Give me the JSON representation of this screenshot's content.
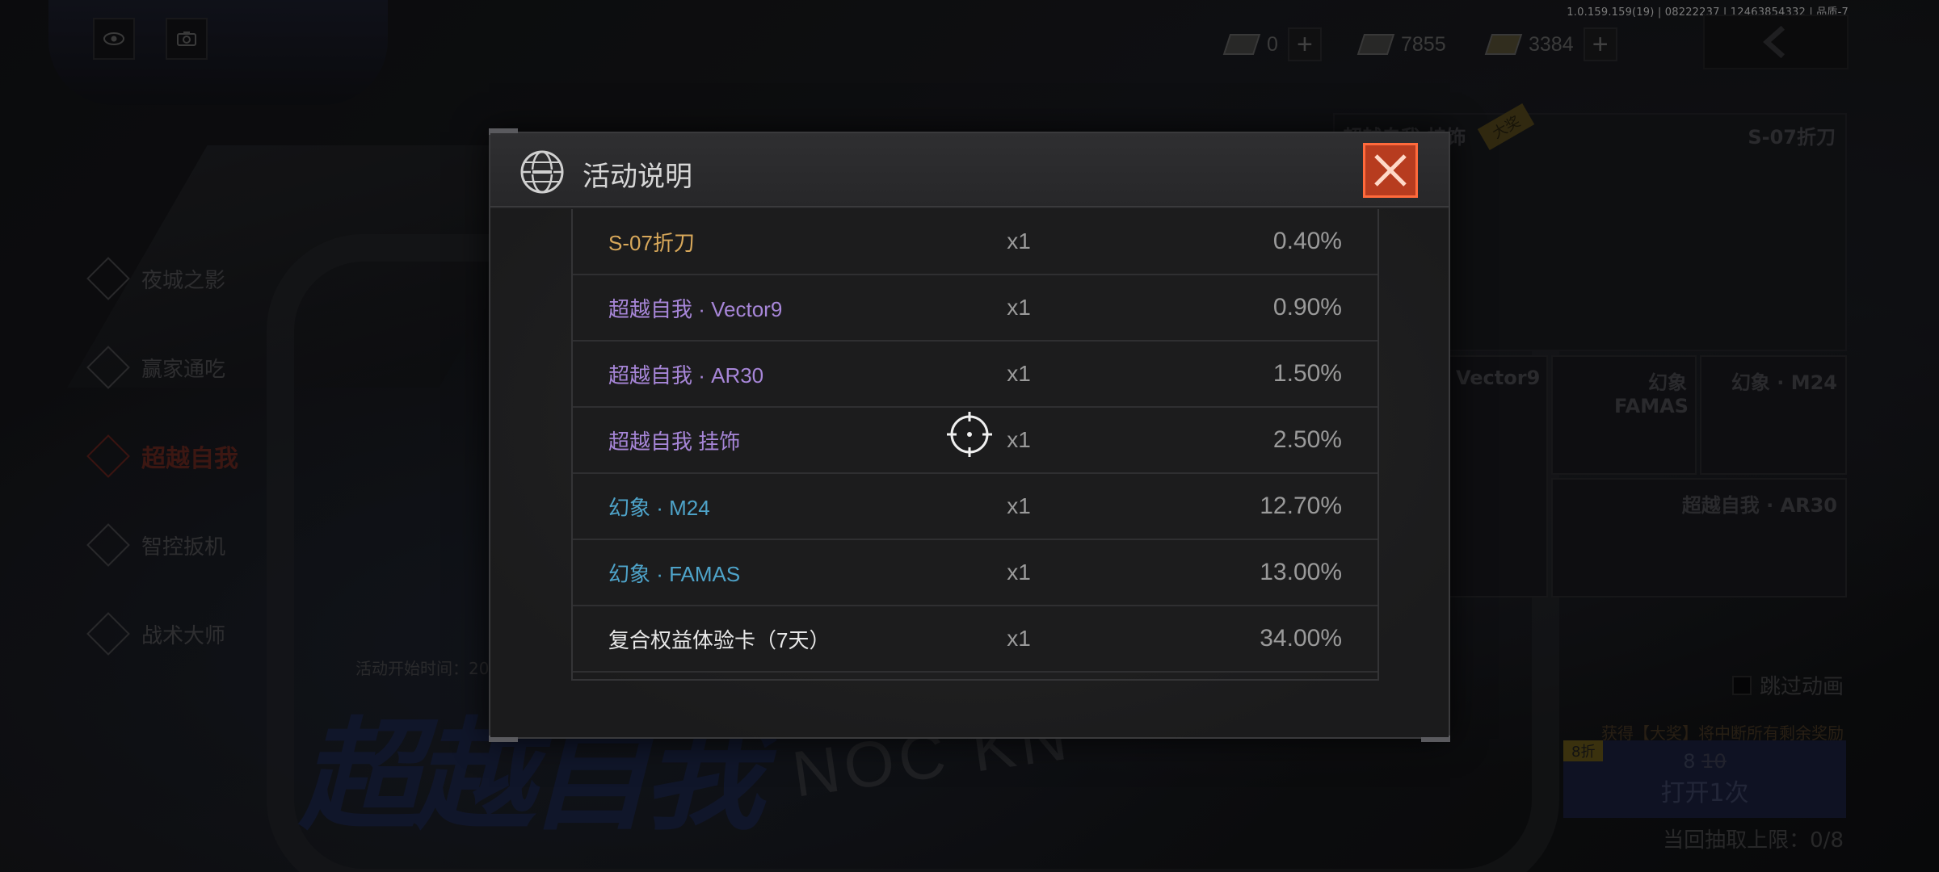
{
  "version_info": "1.0.159.159(19) | 08222237 | 12463854332 | 品质-7",
  "top_icons": {
    "eye": "eye-icon",
    "camera": "camera-icon"
  },
  "currencies": [
    {
      "icon": "ticket-icon",
      "value": "0",
      "has_plus": true
    },
    {
      "icon": "coupon-icon",
      "value": "7855",
      "has_plus": false
    },
    {
      "icon": "gold-icon",
      "value": "3384",
      "has_plus": true
    }
  ],
  "menu": [
    {
      "label": "夜城之影",
      "active": false
    },
    {
      "label": "赢家通吃",
      "active": false
    },
    {
      "label": "超越自我",
      "active": true
    },
    {
      "label": "智控扳机",
      "active": false
    },
    {
      "label": "战术大师",
      "active": false
    }
  ],
  "start_time": "活动开始时间：20",
  "banner": {
    "logo": "超越自我",
    "brand": "NOC KN"
  },
  "reward_grid": {
    "main_tag": "大奖",
    "labels": [
      "超越自我 挂饰",
      "S-07折刀",
      "Vector9",
      "幻象 FAMAS",
      "幻象 · M24",
      "超越自我 · AR30"
    ]
  },
  "skip_animation": "跳过动画",
  "got_text": "获得【大奖】将中断所有剩余奖励",
  "open_button": {
    "discount": "8折",
    "price_now": "8",
    "price_old": "10",
    "label": "打开1次"
  },
  "limit_text": "当回抽取上限：0/8",
  "modal": {
    "title": "活动说明",
    "rows": [
      {
        "name": "S-07折刀",
        "qty": "x1",
        "rate": "0.40%",
        "rarity": "gold"
      },
      {
        "name": "超越自我 · Vector9",
        "qty": "x1",
        "rate": "0.90%",
        "rarity": "purple"
      },
      {
        "name": "超越自我 · AR30",
        "qty": "x1",
        "rate": "1.50%",
        "rarity": "purple"
      },
      {
        "name": "超越自我 挂饰",
        "qty": "x1",
        "rate": "2.50%",
        "rarity": "purple"
      },
      {
        "name": "幻象 · M24",
        "qty": "x1",
        "rate": "12.70%",
        "rarity": "blue"
      },
      {
        "name": "幻象 · FAMAS",
        "qty": "x1",
        "rate": "13.00%",
        "rarity": "blue"
      },
      {
        "name": "复合权益体验卡（7天）",
        "qty": "x1",
        "rate": "34.00%",
        "rarity": "white"
      }
    ]
  },
  "colors": {
    "gold": "#d8a85a",
    "purple": "#a786d8",
    "blue": "#4ea3c9",
    "white": "#e8e8e8",
    "close_button": "#b73c1f"
  }
}
